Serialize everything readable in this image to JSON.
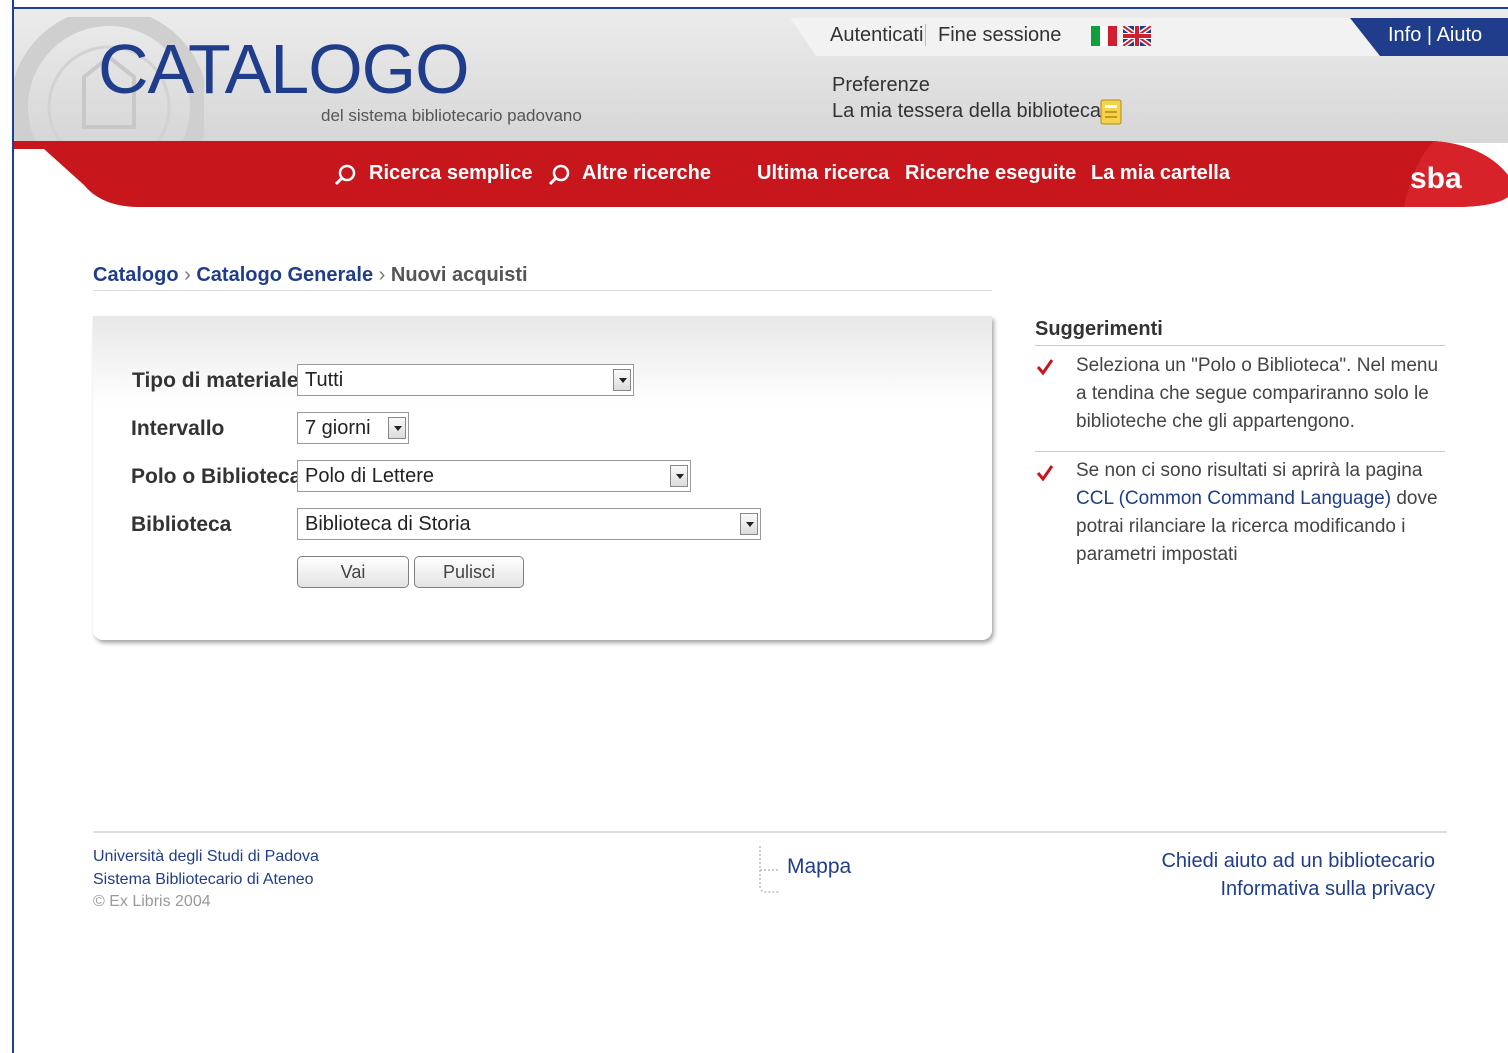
{
  "header": {
    "logo_title": "CATALOGO",
    "logo_subtitle": "del sistema bibliotecario padovano",
    "login_link": "Autenticati",
    "logout_link": "Fine sessione",
    "info_help": "Info | Aiuto",
    "preferences": "Preferenze",
    "library_card": "La mia tessera della biblioteca"
  },
  "nav": {
    "simple_search": "Ricerca semplice",
    "other_searches": "Altre ricerche",
    "last_search": "Ultima ricerca",
    "searches_done": "Ricerche eseguite",
    "my_folder": "La mia cartella",
    "brand_logo": "sba",
    "colors": {
      "bar": "#c8161d"
    }
  },
  "breadcrumb": {
    "items": [
      "Catalogo",
      "Catalogo Generale"
    ],
    "current": "Nuovi acquisti",
    "separator": "›"
  },
  "form": {
    "material_label": "Tipo di materiale",
    "material_value": "Tutti",
    "interval_label": "Intervallo",
    "interval_value": "7 giorni",
    "pole_label": "Polo o Biblioteca",
    "pole_value": "Polo di Lettere",
    "library_label": "Biblioteca",
    "library_value": "Biblioteca di Storia",
    "go_button": "Vai",
    "clear_button": "Pulisci"
  },
  "suggestions": {
    "title": "Suggerimenti",
    "tip1": "Seleziona un \"Polo o Biblioteca\". Nel menu a tendina che segue compariranno solo le biblioteche che gli appartengono.",
    "tip2_pre": "Se non ci sono risultati si aprirà la pagina",
    "tip2_link": "CCL (Common Command Language)",
    "tip2_post": "dove potrai rilanciare la ricerca modificando i parametri impostati"
  },
  "footer": {
    "university": "Università degli Studi di Padova",
    "library_system": "Sistema Bibliotecario di Ateneo",
    "copyright": "© Ex Libris 2004",
    "map": "Mappa",
    "ask_librarian": "Chiedi aiuto ad un bibliotecario",
    "privacy": "Informativa sulla privacy"
  }
}
